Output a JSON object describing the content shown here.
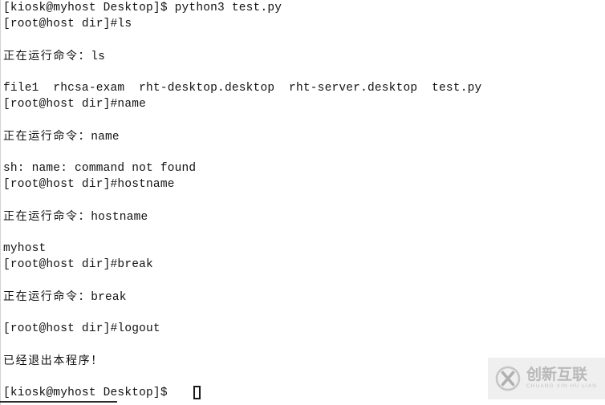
{
  "terminal": {
    "lines": [
      {
        "kind": "mono",
        "text": "[kiosk@myhost Desktop]$ python3 test.py"
      },
      {
        "kind": "mono",
        "text": "[root@host dir]#ls"
      },
      {
        "kind": "blank",
        "text": ""
      },
      {
        "kind": "cjk",
        "prefix": "正在运行命令：",
        "tail": "ls"
      },
      {
        "kind": "blank",
        "text": ""
      },
      {
        "kind": "mono",
        "text": "file1  rhcsa-exam  rht-desktop.desktop  rht-server.desktop  test.py"
      },
      {
        "kind": "mono",
        "text": "[root@host dir]#name"
      },
      {
        "kind": "blank",
        "text": ""
      },
      {
        "kind": "cjk",
        "prefix": "正在运行命令：",
        "tail": "name"
      },
      {
        "kind": "blank",
        "text": ""
      },
      {
        "kind": "mono",
        "text": "sh: name: command not found"
      },
      {
        "kind": "mono",
        "text": "[root@host dir]#hostname"
      },
      {
        "kind": "blank",
        "text": ""
      },
      {
        "kind": "cjk",
        "prefix": "正在运行命令：",
        "tail": "hostname"
      },
      {
        "kind": "blank",
        "text": ""
      },
      {
        "kind": "mono",
        "text": "myhost"
      },
      {
        "kind": "mono",
        "text": "[root@host dir]#break"
      },
      {
        "kind": "blank",
        "text": ""
      },
      {
        "kind": "cjk",
        "prefix": "正在运行命令：",
        "tail": "break"
      },
      {
        "kind": "blank",
        "text": ""
      },
      {
        "kind": "mono",
        "text": "[root@host dir]#logout"
      },
      {
        "kind": "blank",
        "text": ""
      },
      {
        "kind": "cjk",
        "prefix": "已经退出本程序！",
        "tail": ""
      },
      {
        "kind": "blank",
        "text": ""
      },
      {
        "kind": "mono",
        "text": "[kiosk@myhost Desktop]$ "
      }
    ],
    "cursor": {
      "shape": "hollow-block"
    },
    "colors": {
      "background": "#ffffff",
      "foreground": "#111111",
      "rule": "#d2d2d2",
      "bottom_rule": "#2b2b2b"
    }
  },
  "watermark": {
    "logo_icon": "circle-x-logo-icon",
    "brand_cn": "创新互联",
    "brand_en": "CHUANG XIN HU LIAN",
    "background": "#efefef",
    "text_color": "#b9b9b9"
  }
}
